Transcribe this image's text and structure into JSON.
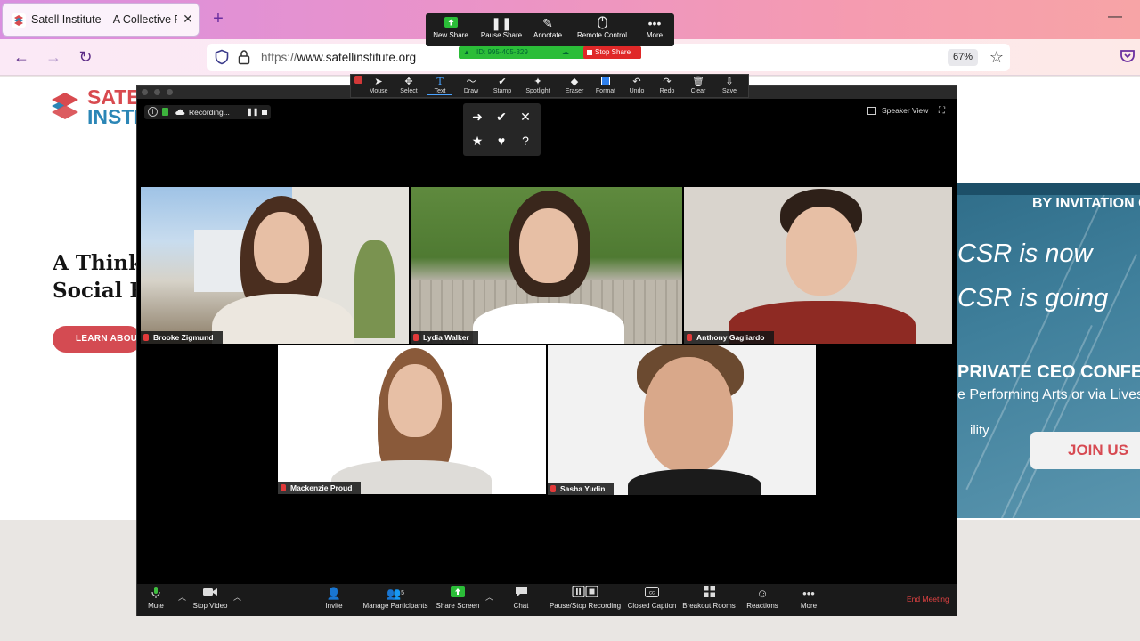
{
  "browser": {
    "tab_title": "Satell Institute – A Collective Fo",
    "url_scheme": "https://",
    "url_host": "www.satellinstitute.org",
    "zoom": "67%"
  },
  "webpage": {
    "logo_line1": "SATE",
    "logo_line2": "INSTIT",
    "hero_line1": "A Think",
    "hero_line2": "Social Re",
    "learn_button": "LEARN ABOUT",
    "banner": {
      "invite": "BY INVITATION O",
      "csr1": "CSR is now",
      "csr2": "CSR is going",
      "conference": "PRIVATE CEO CONFEREN",
      "performing": "e Performing Arts or via Livestr",
      "ility": "ility",
      "join": "JOIN US"
    }
  },
  "zoom": {
    "status": {
      "recording": "Recording...",
      "pause": "❚❚"
    },
    "speaker_view": "Speaker View",
    "participants": [
      {
        "name": "Brooke Zigmund"
      },
      {
        "name": "Lydia Walker"
      },
      {
        "name": "Anthony Gagliardo"
      },
      {
        "name": "Mackenzie Proud"
      },
      {
        "name": "Sasha Yudin"
      }
    ],
    "toolbar": {
      "mute": "Mute",
      "stop_video": "Stop Video",
      "invite": "Invite",
      "manage_participants": "Manage Participants",
      "participant_count": "5",
      "share_screen": "Share Screen",
      "chat": "Chat",
      "recording": "Pause/Stop Recording",
      "closed_caption": "Closed Caption",
      "breakout_rooms": "Breakout Rooms",
      "reactions": "Reactions",
      "more": "More",
      "end_meeting": "End Meeting"
    },
    "share_bar": {
      "new_share": "New Share",
      "pause_share": "Pause Share",
      "annotate": "Annotate",
      "remote_control": "Remote Control",
      "more": "More",
      "meeting_id": "ID: 995-405-329",
      "stop_share": "Stop Share"
    },
    "annotate_bar": {
      "tools": [
        "Mouse",
        "Select",
        "Text",
        "Draw",
        "Stamp",
        "Spotlight",
        "Eraser",
        "Format",
        "Undo",
        "Redo",
        "Clear",
        "Save"
      ]
    },
    "stamps": [
      "➜",
      "✔",
      "✕",
      "★",
      "♥",
      "?"
    ]
  },
  "colors": {
    "accent_red": "#d44b52",
    "zoom_green": "#2bbd38",
    "zoom_red": "#e02828",
    "brand_blue": "#2b86b6"
  }
}
